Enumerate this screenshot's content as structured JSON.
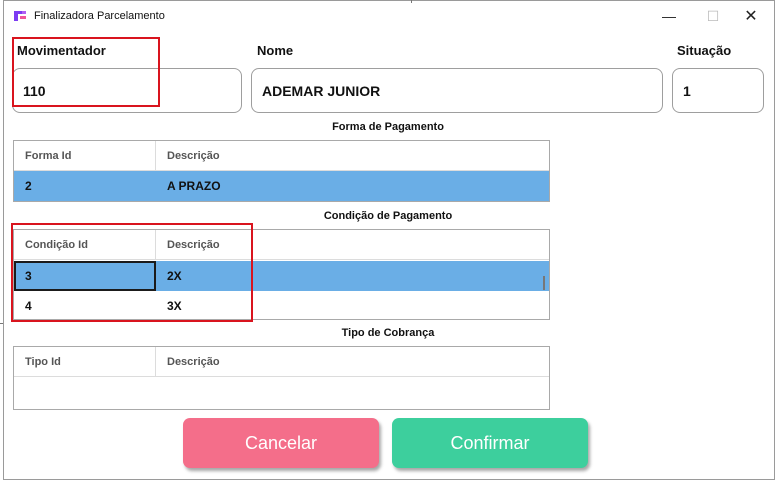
{
  "window": {
    "title": "Finalizadora Parcelamento",
    "controls": {
      "minimize": "—",
      "maximize": "☐",
      "close": "✕"
    },
    "icon": "app-icon"
  },
  "fields": {
    "movimentador": {
      "label": "Movimentador",
      "value": "110"
    },
    "nome": {
      "label": "Nome",
      "value": "ADEMAR JUNIOR"
    },
    "situacao": {
      "label": "Situação",
      "value": "1"
    }
  },
  "forma_pagamento": {
    "title": "Forma de Pagamento",
    "columns": [
      "Forma Id",
      "Descrição"
    ],
    "rows": [
      {
        "id": "2",
        "descricao": "A PRAZO",
        "selected": true
      }
    ]
  },
  "condicao_pagamento": {
    "title": "Condição de Pagamento",
    "columns": [
      "Condição Id",
      "Descrição"
    ],
    "rows": [
      {
        "id": "3",
        "descricao": "2X",
        "selected": true
      },
      {
        "id": "4",
        "descricao": "3X",
        "selected": false
      }
    ]
  },
  "tipo_cobranca": {
    "title": "Tipo de Cobrança",
    "columns": [
      "Tipo Id",
      "Descrição"
    ],
    "rows": []
  },
  "buttons": {
    "cancel": "Cancelar",
    "confirm": "Confirmar"
  },
  "colors": {
    "selected_row": "#6aaee6",
    "cancel_button": "#f46e8a",
    "confirm_button": "#3dcf9d",
    "annotation": "#d9141e"
  }
}
